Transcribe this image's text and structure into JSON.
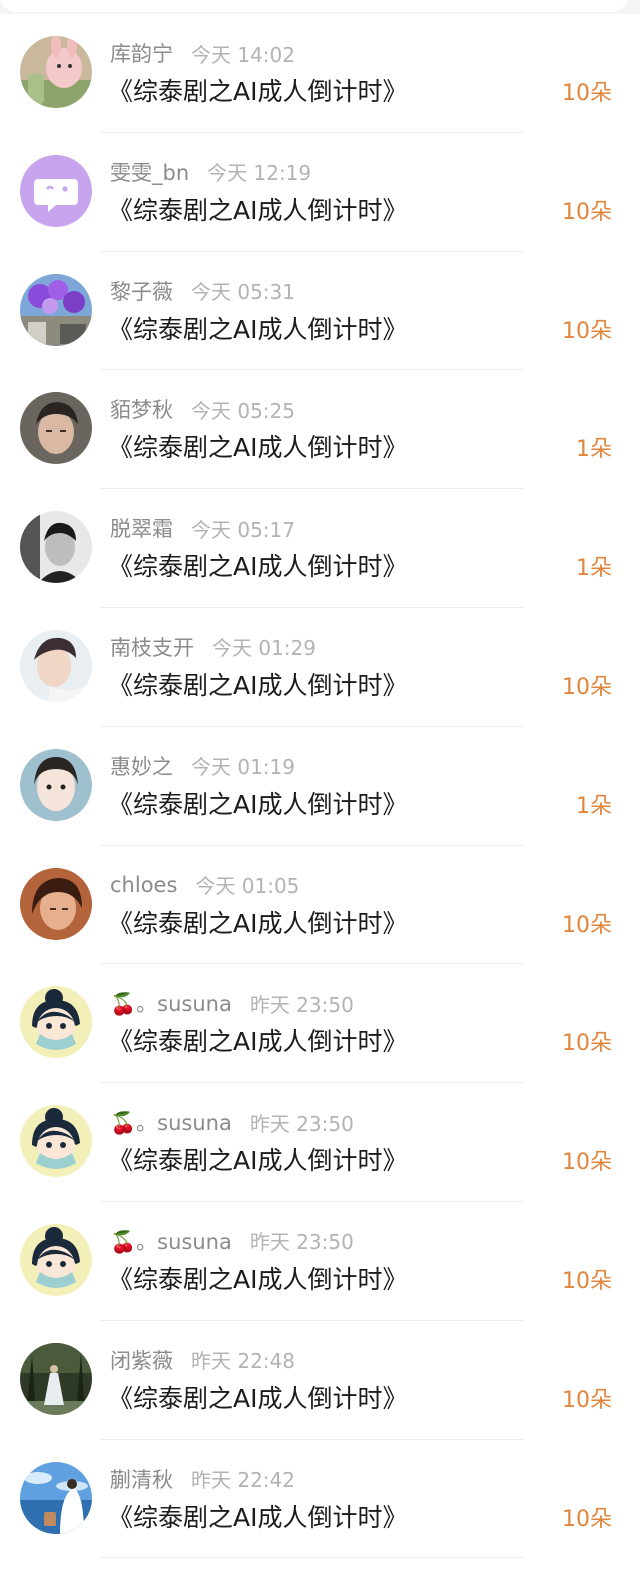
{
  "gift_color": "#e2853c",
  "records": [
    {
      "name": "库韵宁",
      "time": "今天 14:02",
      "title": "《综泰剧之AI成人倒计时》",
      "gift": "10朵",
      "avatar": "pink-bunny-avatar"
    },
    {
      "name": "雯雯_bn",
      "time": "今天 12:19",
      "title": "《综泰剧之AI成人倒计时》",
      "gift": "10朵",
      "avatar": "purple-chat-bubble-avatar"
    },
    {
      "name": "黎子薇",
      "time": "今天 05:31",
      "title": "《综泰剧之AI成人倒计时》",
      "gift": "10朵",
      "avatar": "purple-flowers-avatar"
    },
    {
      "name": "貊梦秋",
      "time": "今天 05:25",
      "title": "《综泰剧之AI成人倒计时》",
      "gift": "1朵",
      "avatar": "man-portrait-avatar"
    },
    {
      "name": "脱翠霜",
      "time": "今天 05:17",
      "title": "《综泰剧之AI成人倒计时》",
      "gift": "1朵",
      "avatar": "bw-man-portrait-avatar"
    },
    {
      "name": "南枝支开",
      "time": "今天 01:29",
      "title": "《综泰剧之AI成人倒计时》",
      "gift": "10朵",
      "avatar": "young-man-avatar"
    },
    {
      "name": "惠妙之",
      "time": "今天 01:19",
      "title": "《综泰剧之AI成人倒计时》",
      "gift": "1朵",
      "avatar": "girl-selfie-avatar"
    },
    {
      "name": "chloes",
      "time": "今天 01:05",
      "title": "《综泰剧之AI成人倒计时》",
      "gift": "10朵",
      "avatar": "girl-warm-tone-avatar"
    },
    {
      "name": "🍒。susuna",
      "time": "昨天 23:50",
      "title": "《综泰剧之AI成人倒计时》",
      "gift": "10朵",
      "avatar": "cartoon-masked-girl-avatar"
    },
    {
      "name": "🍒。susuna",
      "time": "昨天 23:50",
      "title": "《综泰剧之AI成人倒计时》",
      "gift": "10朵",
      "avatar": "cartoon-masked-girl-avatar"
    },
    {
      "name": "🍒。susuna",
      "time": "昨天 23:50",
      "title": "《综泰剧之AI成人倒计时》",
      "gift": "10朵",
      "avatar": "cartoon-masked-girl-avatar"
    },
    {
      "name": "闭紫薇",
      "time": "昨天 22:48",
      "title": "《综泰剧之AI成人倒计时》",
      "gift": "10朵",
      "avatar": "forest-figure-avatar"
    },
    {
      "name": "蒯清秋",
      "time": "昨天 22:42",
      "title": "《综泰剧之AI成人倒计时》",
      "gift": "10朵",
      "avatar": "sky-sea-avatar"
    }
  ]
}
